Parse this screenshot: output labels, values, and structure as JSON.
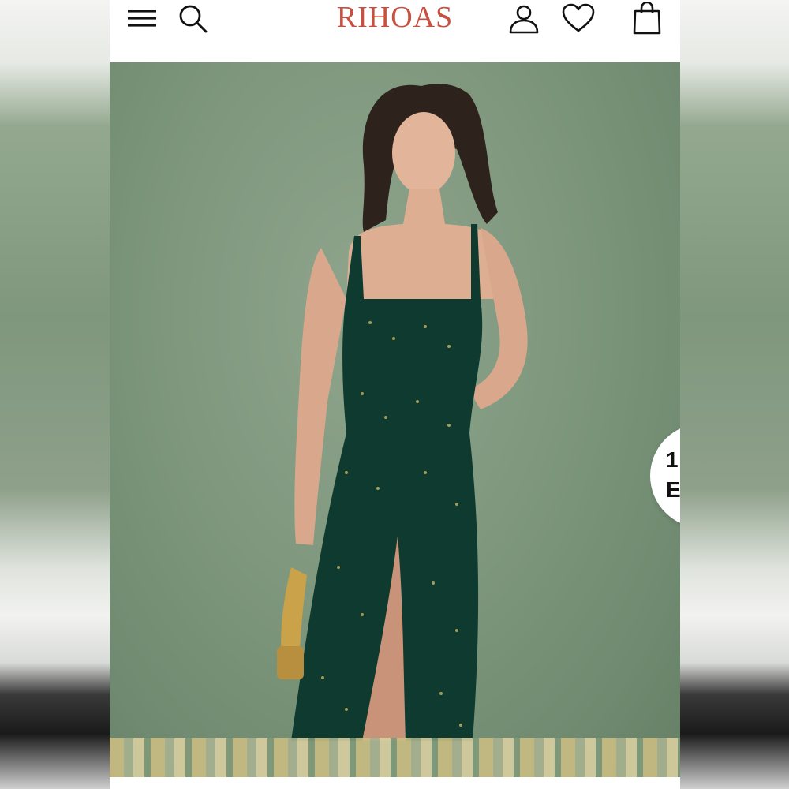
{
  "header": {
    "brand": "RIHOAS",
    "brand_color": "#c8503f",
    "icons": {
      "menu": "hamburger-menu-icon",
      "search": "search-icon",
      "account": "user-icon",
      "wishlist": "heart-icon",
      "cart": "shopping-bag-icon"
    }
  },
  "hero": {
    "image": "product-photo-green-midi-dress",
    "side_badge": {
      "line1": "1",
      "line2": "E"
    }
  },
  "colors": {
    "backdrop": "#7e977d",
    "dress": "#0f3a2f"
  }
}
